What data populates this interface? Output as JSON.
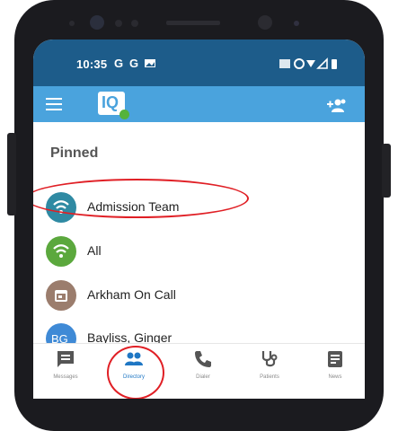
{
  "status_bar": {
    "time": "10:35",
    "icons": [
      "G",
      "G"
    ]
  },
  "app": {
    "logo_text": "IQ"
  },
  "section": {
    "title": "Pinned"
  },
  "contacts": [
    {
      "label": "Admission Team",
      "avatar_icon": "wifi-icon",
      "avatar_color": "#2f8aa3"
    },
    {
      "label": "All",
      "avatar_icon": "wifi-icon",
      "avatar_color": "#5ba83d"
    },
    {
      "label": "Arkham On Call",
      "avatar_icon": "calendar-icon",
      "avatar_color": "#9b7d6d"
    },
    {
      "label": "Bayliss, Ginger",
      "avatar_text": "BG",
      "avatar_color": "#3f8ad6"
    }
  ],
  "bottom_nav": [
    {
      "label": "Messages",
      "icon": "message-icon"
    },
    {
      "label": "Directory",
      "icon": "people-icon",
      "active": true
    },
    {
      "label": "Dialer",
      "icon": "phone-icon"
    },
    {
      "label": "Patients",
      "icon": "stethoscope-icon"
    },
    {
      "label": "News",
      "icon": "news-icon"
    }
  ],
  "colors": {
    "status_bar": "#1d5c8a",
    "app_bar": "#4aa3dd",
    "active_nav": "#1f77c4",
    "annotation": "#e01f25"
  }
}
